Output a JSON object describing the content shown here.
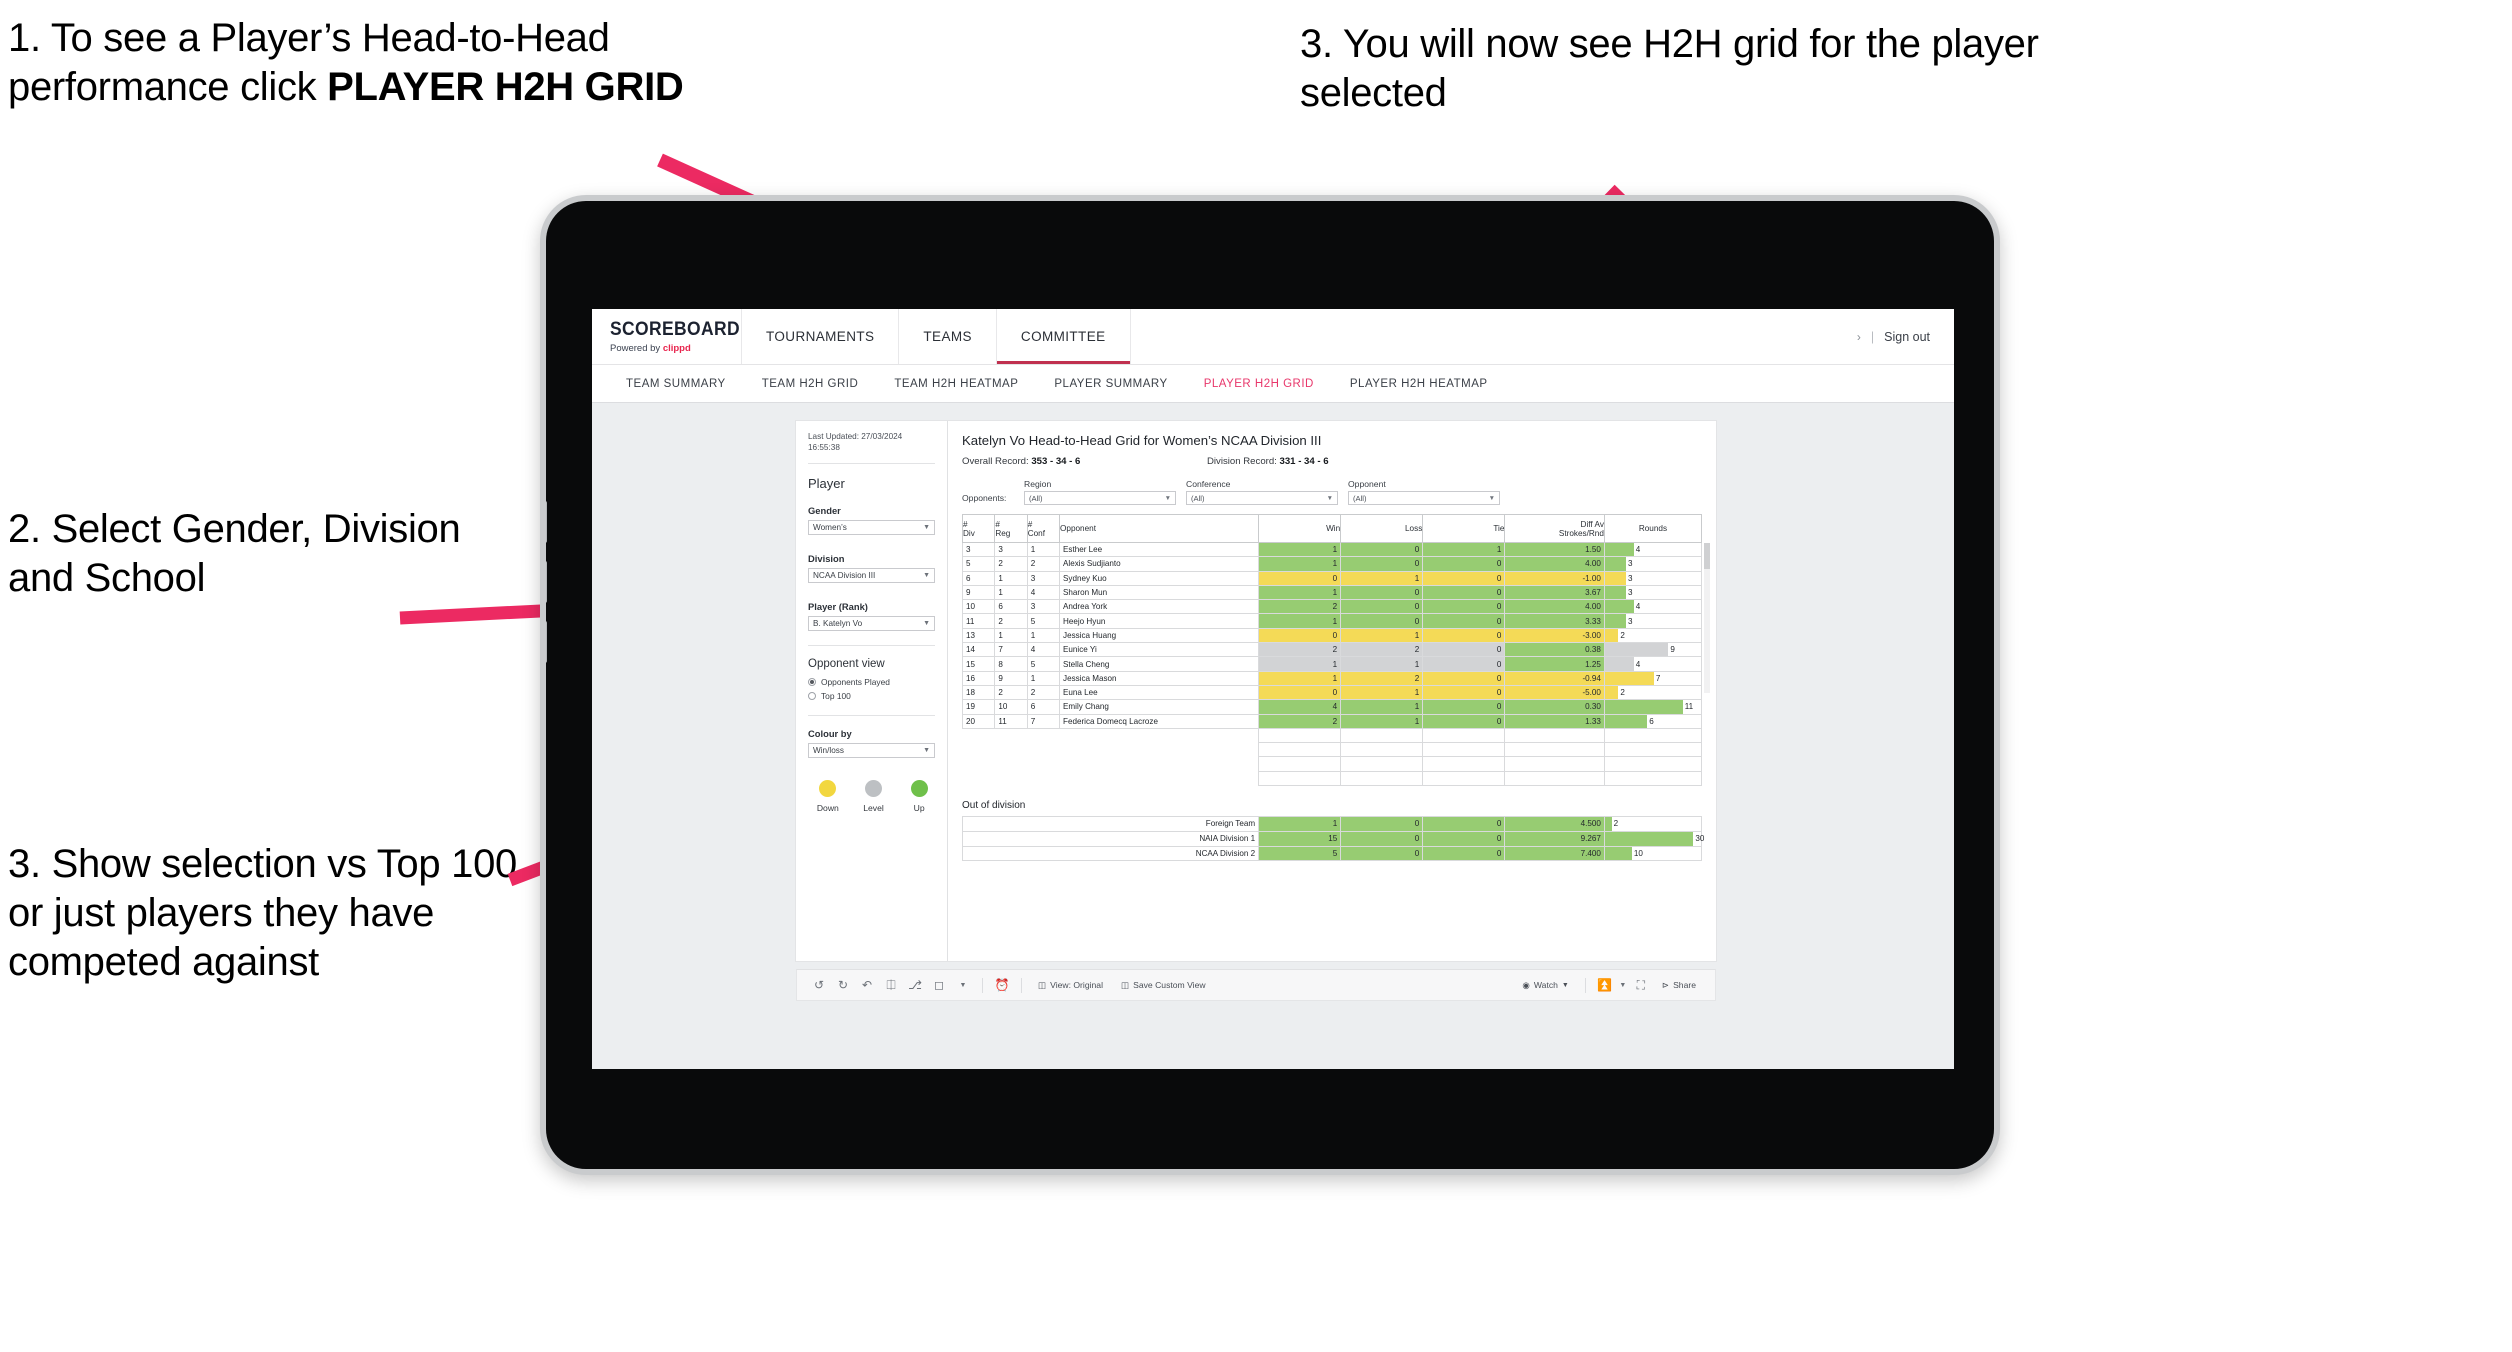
{
  "annotations": {
    "one_a": "1. To see a Player’s Head-to-Head performance click ",
    "one_b": "PLAYER H2H GRID",
    "two": "2. Select Gender, Division and School",
    "three": "3. Show selection vs Top 100 or just players they have competed against",
    "four": "3. You will now see H2H grid for the player selected",
    "arrow_color": "#ec2a62"
  },
  "app": {
    "brand": {
      "title": "SCOREBOARD",
      "powered": "Powered by ",
      "by": "clippd"
    },
    "topnav": [
      {
        "label": "TOURNAMENTS",
        "active": false
      },
      {
        "label": "TEAMS",
        "active": false
      },
      {
        "label": "COMMITTEE",
        "active": true
      }
    ],
    "topright": {
      "chevron": "›",
      "sep": "|",
      "signout": "Sign out"
    },
    "subnav": [
      {
        "label": "TEAM SUMMARY",
        "active": false
      },
      {
        "label": "TEAM H2H GRID",
        "active": false
      },
      {
        "label": "TEAM H2H HEATMAP",
        "active": false
      },
      {
        "label": "PLAYER SUMMARY",
        "active": false
      },
      {
        "label": "PLAYER H2H GRID",
        "active": true
      },
      {
        "label": "PLAYER H2H HEATMAP",
        "active": false
      }
    ],
    "accent": "#e8376b"
  },
  "filters": {
    "last_updated": "Last Updated: 27/03/2024 16:55:38",
    "player_group": "Player",
    "gender": {
      "label": "Gender",
      "value": "Women’s"
    },
    "division": {
      "label": "Division",
      "value": "NCAA Division III"
    },
    "player_rank": {
      "label": "Player (Rank)",
      "value": "B. Katelyn Vo"
    },
    "opponent_view": {
      "title": "Opponent view",
      "options": [
        {
          "label": "Opponents Played",
          "selected": true
        },
        {
          "label": "Top 100",
          "selected": false
        }
      ]
    },
    "colour_by": {
      "label": "Colour by",
      "value": "Win/loss"
    },
    "legend": [
      {
        "label": "Down",
        "color": "#f2d73f"
      },
      {
        "label": "Level",
        "color": "#bdc0c3"
      },
      {
        "label": "Up",
        "color": "#6fc04a"
      }
    ]
  },
  "report": {
    "title": "Katelyn Vo Head-to-Head Grid for Women’s NCAA Division III",
    "overall_record_label": "Overall Record: ",
    "overall_record_value": "353 - 34 - 6",
    "division_record_label": "Division Record: ",
    "division_record_value": "331 - 34 - 6",
    "opponents_label": "Opponents:",
    "opponent_filters": [
      {
        "caption": "Region",
        "value": "(All)"
      },
      {
        "caption": "Conference",
        "value": "(All)"
      },
      {
        "caption": "Opponent",
        "value": "(All)"
      }
    ],
    "out_of_division_title": "Out of division"
  },
  "chart_data": {
    "type": "table",
    "title": "Katelyn Vo Head-to-Head Grid for Women’s NCAA Division III",
    "columns": [
      "# Div",
      "# Reg",
      "# Conf",
      "Opponent",
      "Win",
      "Loss",
      "Tie",
      "Diff Av Strokes/Rnd",
      "Rounds"
    ],
    "column_headers": [
      {
        "l1": "#",
        "l2": "Div"
      },
      {
        "l1": "#",
        "l2": "Reg"
      },
      {
        "l1": "#",
        "l2": "Conf"
      },
      {
        "l1": "Opponent",
        "l2": ""
      },
      {
        "l1": "Win",
        "l2": ""
      },
      {
        "l1": "Loss",
        "l2": ""
      },
      {
        "l1": "Tie",
        "l2": ""
      },
      {
        "l1": "Diff Av",
        "l2": "Strokes/Rnd"
      },
      {
        "l1": "Rounds",
        "l2": ""
      }
    ],
    "rows": [
      {
        "div": "3",
        "reg": "3",
        "conf": "1",
        "opponent": "Esther Lee",
        "win": "1",
        "loss": "0",
        "tie": "1",
        "diff": "1.50",
        "rounds": "4",
        "state": "g",
        "bar_pct": 30
      },
      {
        "div": "5",
        "reg": "2",
        "conf": "2",
        "opponent": "Alexis Sudjianto",
        "win": "1",
        "loss": "0",
        "tie": "0",
        "diff": "4.00",
        "rounds": "3",
        "state": "g",
        "bar_pct": 22
      },
      {
        "div": "6",
        "reg": "1",
        "conf": "3",
        "opponent": "Sydney Kuo",
        "win": "0",
        "loss": "1",
        "tie": "0",
        "diff": "-1.00",
        "rounds": "3",
        "state": "y",
        "bar_pct": 22
      },
      {
        "div": "9",
        "reg": "1",
        "conf": "4",
        "opponent": "Sharon Mun",
        "win": "1",
        "loss": "0",
        "tie": "0",
        "diff": "3.67",
        "rounds": "3",
        "state": "g",
        "bar_pct": 22
      },
      {
        "div": "10",
        "reg": "6",
        "conf": "3",
        "opponent": "Andrea York",
        "win": "2",
        "loss": "0",
        "tie": "0",
        "diff": "4.00",
        "rounds": "4",
        "state": "g",
        "bar_pct": 30
      },
      {
        "div": "11",
        "reg": "2",
        "conf": "5",
        "opponent": "Heejo Hyun",
        "win": "1",
        "loss": "0",
        "tie": "0",
        "diff": "3.33",
        "rounds": "3",
        "state": "g",
        "bar_pct": 22
      },
      {
        "div": "13",
        "reg": "1",
        "conf": "1",
        "opponent": "Jessica Huang",
        "win": "0",
        "loss": "1",
        "tie": "0",
        "diff": "-3.00",
        "rounds": "2",
        "state": "y",
        "bar_pct": 14
      },
      {
        "div": "14",
        "reg": "7",
        "conf": "4",
        "opponent": "Eunice Yi",
        "win": "2",
        "loss": "2",
        "tie": "0",
        "diff": "0.38",
        "rounds": "9",
        "state": "n",
        "diff_state": "g",
        "bar_pct": 66
      },
      {
        "div": "15",
        "reg": "8",
        "conf": "5",
        "opponent": "Stella Cheng",
        "win": "1",
        "loss": "1",
        "tie": "0",
        "diff": "1.25",
        "rounds": "4",
        "state": "n",
        "diff_state": "g",
        "bar_pct": 30
      },
      {
        "div": "16",
        "reg": "9",
        "conf": "1",
        "opponent": "Jessica Mason",
        "win": "1",
        "loss": "2",
        "tie": "0",
        "diff": "-0.94",
        "rounds": "7",
        "state": "y",
        "bar_pct": 51
      },
      {
        "div": "18",
        "reg": "2",
        "conf": "2",
        "opponent": "Euna Lee",
        "win": "0",
        "loss": "1",
        "tie": "0",
        "diff": "-5.00",
        "rounds": "2",
        "state": "y",
        "bar_pct": 14
      },
      {
        "div": "19",
        "reg": "10",
        "conf": "6",
        "opponent": "Emily Chang",
        "win": "4",
        "loss": "1",
        "tie": "0",
        "diff": "0.30",
        "rounds": "11",
        "state": "g",
        "bar_pct": 81
      },
      {
        "div": "20",
        "reg": "11",
        "conf": "7",
        "opponent": "Federica Domecq Lacroze",
        "win": "2",
        "loss": "1",
        "tie": "0",
        "diff": "1.33",
        "rounds": "6",
        "state": "g",
        "bar_pct": 44
      }
    ],
    "out_of_division": {
      "title": "Out of division",
      "rows": [
        {
          "name": "Foreign Team",
          "win": "1",
          "loss": "0",
          "tie": "0",
          "diff": "4.500",
          "rounds": "2",
          "state": "g",
          "bar_pct": 7
        },
        {
          "name": "NAIA Division 1",
          "win": "15",
          "loss": "0",
          "tie": "0",
          "diff": "9.267",
          "rounds": "30",
          "state": "g",
          "bar_pct": 92
        },
        {
          "name": "NCAA Division 2",
          "win": "5",
          "loss": "0",
          "tie": "0",
          "diff": "7.400",
          "rounds": "10",
          "state": "g",
          "bar_pct": 28
        }
      ]
    },
    "colors": {
      "up": "#97cc72",
      "down": "#f4da57",
      "level": "#d2d3d5"
    }
  },
  "toolbar": {
    "icons": [
      "undo-icon",
      "redo-icon",
      "revert-icon",
      "refresh-icon",
      "pause-icon",
      "shape-icon",
      "caret-icon"
    ],
    "clock": "clock-icon",
    "view_original": "View: Original",
    "save_custom_view": "Save Custom View",
    "watch": "Watch",
    "download": "download-icon",
    "fullscreen": "fullscreen-icon",
    "share": "Share"
  }
}
